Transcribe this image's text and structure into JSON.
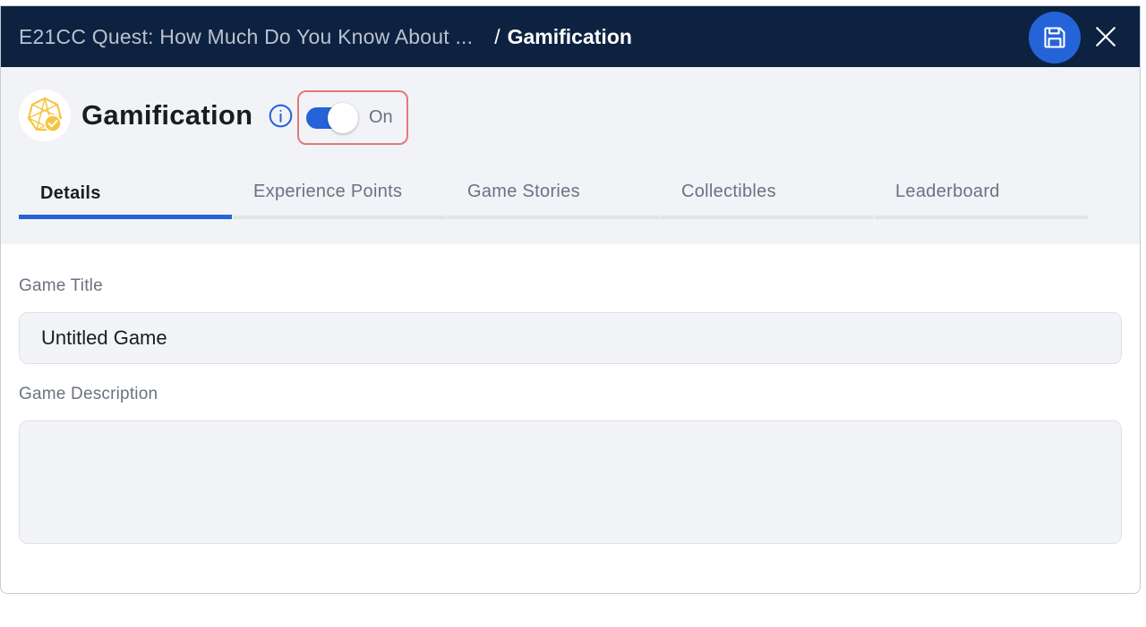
{
  "titlebar": {
    "parent": "E21CC Quest: How Much Do You Know About ...",
    "separator": "/",
    "current": "Gamification"
  },
  "header": {
    "heading": "Gamification",
    "toggle": {
      "state_label": "On",
      "checked": true
    }
  },
  "tabs": [
    {
      "label": "Details",
      "active": true
    },
    {
      "label": "Experience Points",
      "active": false
    },
    {
      "label": "Game Stories",
      "active": false
    },
    {
      "label": "Collectibles",
      "active": false
    },
    {
      "label": "Leaderboard",
      "active": false
    }
  ],
  "form": {
    "title_label": "Game Title",
    "title_value": "Untitled Game",
    "description_label": "Game Description",
    "description_value": ""
  },
  "colors": {
    "titlebar_bg": "#0d2240",
    "accent": "#2563d8",
    "highlight_border": "#e4787c",
    "badge_gold": "#f5c542"
  },
  "icons": {
    "save": "floppy-disk-icon",
    "close": "close-icon",
    "badge": "gamification-badge-icon",
    "info": "info-icon"
  }
}
